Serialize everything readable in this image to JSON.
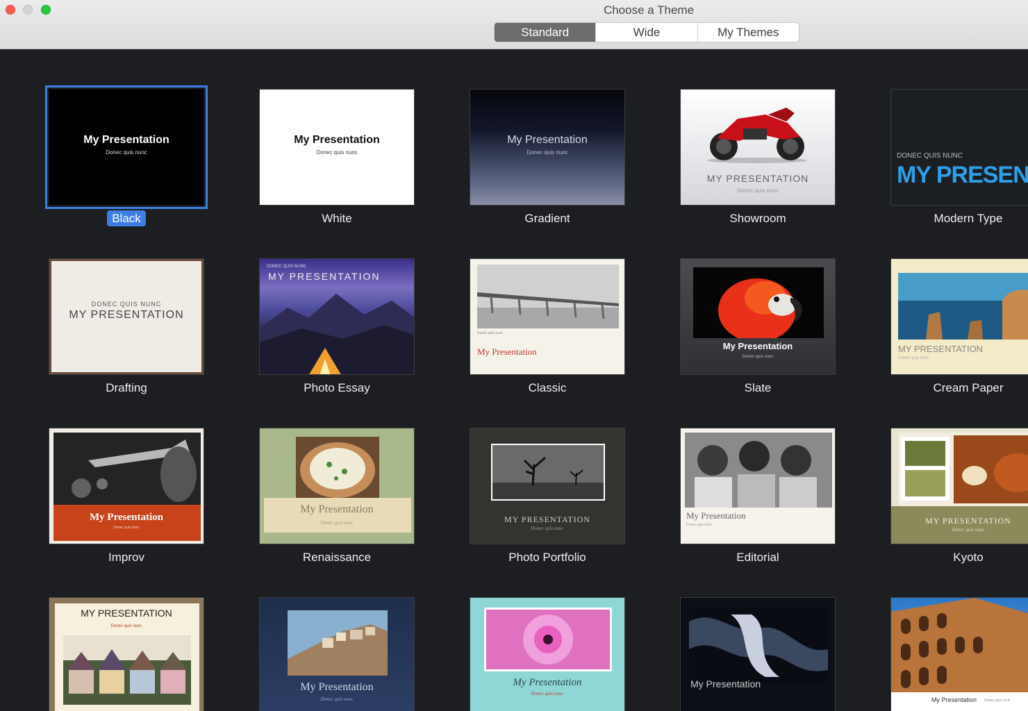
{
  "window": {
    "title": "Choose a Theme",
    "tabs": [
      {
        "label": "Standard",
        "active": true
      },
      {
        "label": "Wide",
        "active": false
      },
      {
        "label": "My Themes",
        "active": false
      }
    ]
  },
  "colors": {
    "accent": "#3d7de4",
    "background": "#1c1e21"
  },
  "sample": {
    "title": "My Presentation",
    "title_caps": "MY PRESENTATION",
    "title_caps_cut": "MY PRESENTATIO",
    "subtitle": "Donec quis nunc",
    "subtitle_caps": "DONEC QUIS NUNC"
  },
  "themes": [
    {
      "name": "Black",
      "selected": true
    },
    {
      "name": "White"
    },
    {
      "name": "Gradient"
    },
    {
      "name": "Showroom",
      "image": "motorcycle"
    },
    {
      "name": "Modern Type"
    },
    {
      "name": "Drafting"
    },
    {
      "name": "Photo Essay",
      "image": "mountain-tent"
    },
    {
      "name": "Classic",
      "image": "bridge"
    },
    {
      "name": "Slate",
      "image": "parrot"
    },
    {
      "name": "Cream Paper",
      "image": "coastline"
    },
    {
      "name": "Improv",
      "image": "trumpet"
    },
    {
      "name": "Renaissance",
      "image": "food-bowl"
    },
    {
      "name": "Photo Portfolio",
      "image": "trees"
    },
    {
      "name": "Editorial",
      "image": "children"
    },
    {
      "name": "Kyoto",
      "image": "tea"
    },
    {
      "name": "",
      "image": "houses"
    },
    {
      "name": "",
      "image": "hillside-town"
    },
    {
      "name": "",
      "image": "flower"
    },
    {
      "name": "",
      "image": "abstract-metal"
    },
    {
      "name": "",
      "image": "colosseum"
    }
  ]
}
